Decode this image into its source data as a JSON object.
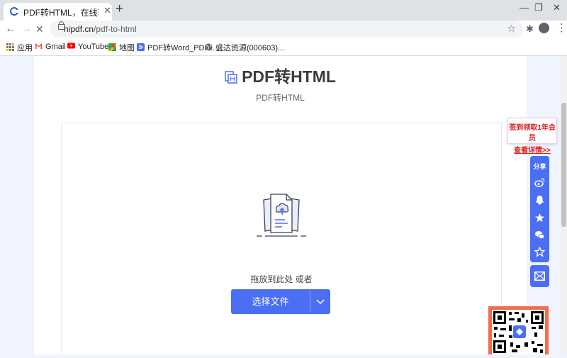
{
  "browser": {
    "tab_title": "PDF转HTML，在线转换，无需任何",
    "url_host": "hipdf.cn",
    "url_path": "/pdf-to-html",
    "window_min": "—",
    "window_restore": "❐",
    "window_close": "✕"
  },
  "bookmarks": [
    {
      "label": "应用",
      "icon": "apps-grid-icon"
    },
    {
      "label": "Gmail",
      "icon": "gmail-icon"
    },
    {
      "label": "YouTube",
      "icon": "youtube-icon"
    },
    {
      "label": "地图",
      "icon": "maps-icon"
    },
    {
      "label": "PDF转Word_PDF...",
      "icon": "hipdf-icon"
    },
    {
      "label": "盛达资源(000603)...",
      "icon": "globe-icon"
    }
  ],
  "page": {
    "title": "PDF转HTML",
    "subtitle": "PDF转HTML",
    "drop_hint": "拖放到此处 或者",
    "choose_button": "选择文件"
  },
  "promo": {
    "line1": "签到领取1年会员",
    "line2": "查看详情>>"
  },
  "share": {
    "label": "分享",
    "icons": [
      "weibo-icon",
      "qq-icon",
      "qzone-icon",
      "wechat-icon",
      "favorite-star-icon"
    ]
  },
  "colors": {
    "accent": "#4b6ef5",
    "promo_red": "#e02020",
    "qr_border": "#f26c4f"
  }
}
